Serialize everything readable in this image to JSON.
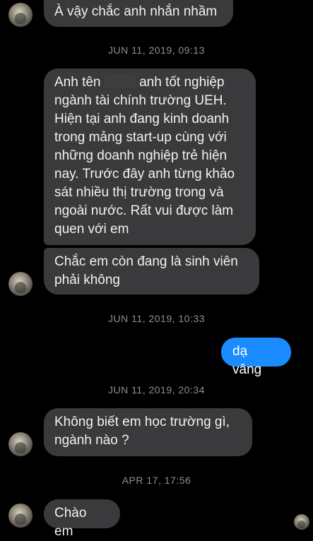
{
  "messages": {
    "m1": "À vậy chắc anh nhắn nhầm",
    "m2_before": "Anh tên",
    "m2_after": "anh tốt nghiệp ngành tài chính trường UEH. Hiện tại anh đang kinh doanh trong mảng start-up cùng với những doanh nghiệp trẻ hiện nay. Trước đây anh từng khảo sát nhiều thị trường trong và ngoài nước. Rất vui được làm quen với em",
    "m3": "Chắc em còn đang là sinh viên phải không",
    "m4": "dạ vâng",
    "m5": "Không biết em học trường gì, ngành nào ?",
    "m6": "Chào em"
  },
  "timestamps": {
    "t1": "JUN 11, 2019, 09:13",
    "t2": "JUN 11, 2019, 10:33",
    "t3": "JUN 11, 2019, 20:34",
    "t4": "APR 17, 17:56"
  },
  "colors": {
    "background": "#000000",
    "incoming_bubble": "#3a3a3c",
    "outgoing_bubble": "#1a8cff",
    "timestamp": "#8e8e93"
  }
}
